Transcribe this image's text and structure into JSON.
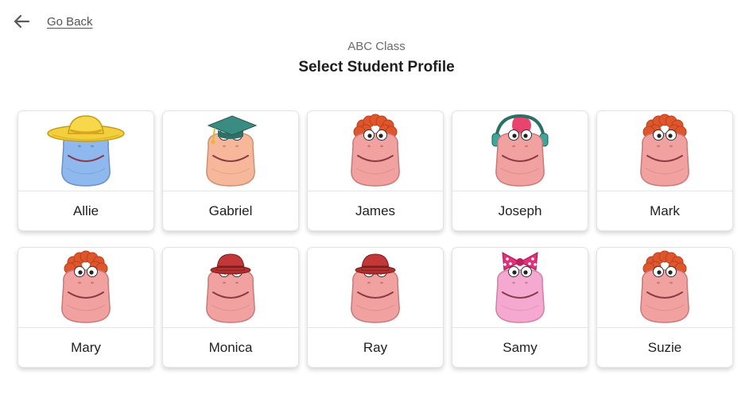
{
  "nav": {
    "back_label": "Go Back",
    "back_icon": "arrow-left-icon"
  },
  "header": {
    "class_name": "ABC Class",
    "title": "Select Student Profile"
  },
  "students": [
    {
      "name": "Allie",
      "face": "blue",
      "accessory": "sombrero"
    },
    {
      "name": "Gabriel",
      "face": "peach",
      "accessory": "grad-cap"
    },
    {
      "name": "James",
      "face": "pink",
      "accessory": "curly-hair"
    },
    {
      "name": "Joseph",
      "face": "pink",
      "accessory": "headphones"
    },
    {
      "name": "Mark",
      "face": "pink",
      "accessory": "curly-hair"
    },
    {
      "name": "Mary",
      "face": "pink",
      "accessory": "curly-hair"
    },
    {
      "name": "Monica",
      "face": "pink",
      "accessory": "bowler-hat"
    },
    {
      "name": "Ray",
      "face": "pink",
      "accessory": "bowler-hat"
    },
    {
      "name": "Samy",
      "face": "light-pink",
      "accessory": "polka-bow"
    },
    {
      "name": "Suzie",
      "face": "pink",
      "accessory": "curly-hair"
    }
  ],
  "colors": {
    "blue": "#8fb8ef",
    "peach": "#f6b79a",
    "pink": "#f2a1a1",
    "light-pink": "#f6a9d0",
    "hair": "#e0562c",
    "outline": "#b8706a",
    "mouth": "#8a3c46"
  }
}
